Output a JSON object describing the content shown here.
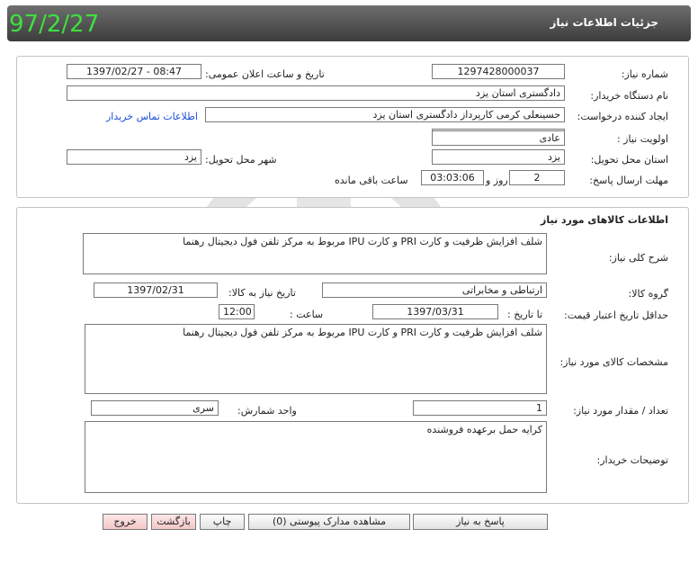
{
  "header": {
    "title": "جزئیات اطلاعات نیاز",
    "date_stamp": "97/2/27"
  },
  "info": {
    "need_number_label": "شماره نیاز:",
    "need_number": "1297428000037",
    "announce_label": "تاریخ و ساعت اعلان عمومی:",
    "announce_value": "1397/02/27 - 08:47",
    "buyer_label": "نام دستگاه خریدار:",
    "buyer": "دادگستری استان یزد",
    "requester_label": "ایجاد کننده درخواست:",
    "requester": "حسینعلی کرمی کارپرداز  دادگستری استان یزد",
    "contact_link": "اطلاعات تماس خریدار",
    "priority_label": "اولویت نیاز :",
    "priority": "عادی",
    "province_label": "استان محل تحویل:",
    "province": "یزد",
    "city_label": "شهر محل تحویل:",
    "city": "یزد",
    "deadline_label": "مهلت ارسال پاسخ:",
    "days_value": "2",
    "days_label": "روز و",
    "time_value": "03:03:06",
    "remaining_label": "ساعت باقی مانده"
  },
  "goods": {
    "section_title": "اطلاعات کالاهای مورد نیاز",
    "desc_label": "شرح کلی نیاز:",
    "desc": "شلف افزایش ظرفیت و کارت PRI  و کارت IPU مربوط به مرکز تلفن فول دیجیتال رهنما",
    "group_label": "گروه کالا:",
    "group": "ارتباطی و مخابراتی",
    "need_date_label": "تاریخ نیاز به کالا:",
    "need_date": "1397/02/31",
    "validity_label": "حداقل تاریخ اعتبار قیمت:",
    "until_date_label": "تا تاریخ :",
    "until_date": "1397/03/31",
    "hour_label": "ساعت :",
    "hour": "12:00",
    "specs_label": "مشخصات کالای مورد نیاز:",
    "specs": "شلف افزایش ظرفیت و کارت PRI  و کارت IPU مربوط به مرکز تلفن فول دیجیتال رهنما",
    "qty_label": "تعداد / مقدار مورد نیاز:",
    "qty": "1",
    "unit_label": "واحد شمارش:",
    "unit": "سری",
    "notes_label": "توضیحات خریدار:",
    "notes": "کرایه حمل برعهده فروشنده"
  },
  "buttons": {
    "respond": "پاسخ به نیاز",
    "attachments": "مشاهده مدارک پیوستی (0)",
    "print": "چاپ",
    "back": "بازگشت",
    "exit": "خروج"
  }
}
